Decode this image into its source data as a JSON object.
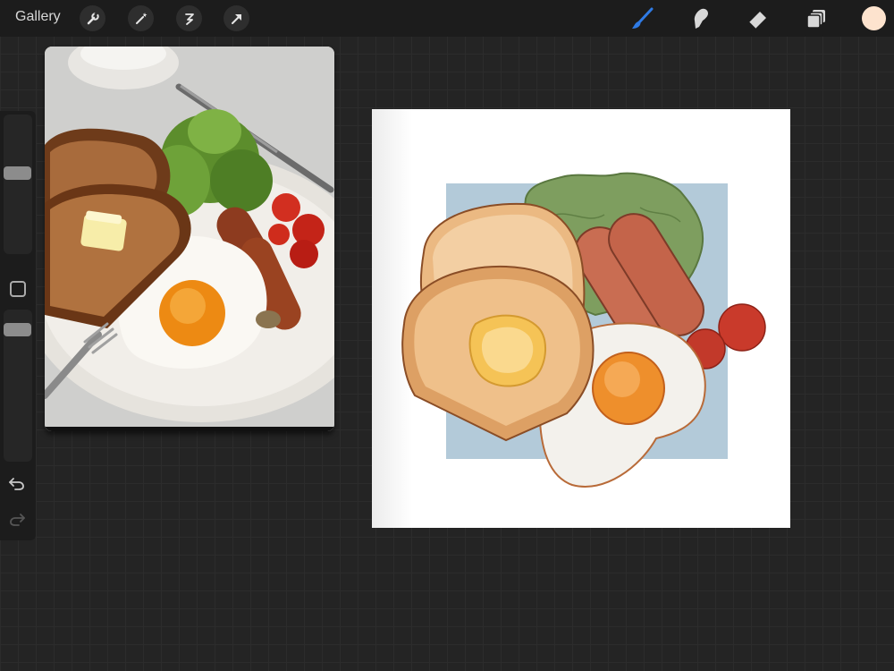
{
  "topbar": {
    "gallery_label": "Gallery",
    "left_tools": [
      {
        "name": "wrench-icon"
      },
      {
        "name": "magic-wand-icon"
      },
      {
        "name": "selection-icon"
      },
      {
        "name": "transform-arrow-icon"
      }
    ],
    "right_tools": [
      {
        "name": "brush-icon",
        "active_color": "#2f7be5"
      },
      {
        "name": "smudge-icon"
      },
      {
        "name": "eraser-icon"
      },
      {
        "name": "layers-icon"
      }
    ],
    "current_color": "#fde3ce"
  },
  "sidebar": {
    "brush_size_slider": "brush-size",
    "opacity_slider": "opacity",
    "modify_button": "modify",
    "undo": "undo-icon",
    "redo": "redo-icon"
  },
  "reference": {
    "description_icon": "breakfast-photo"
  },
  "canvas": {
    "background_square_color": "#b3cad9"
  }
}
